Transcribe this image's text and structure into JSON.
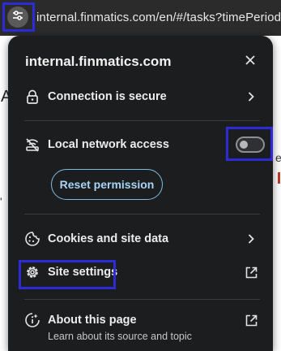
{
  "address_bar": {
    "url": "internal.finmatics.com/en/#/tasks?timePeriod="
  },
  "page_peek": {
    "left_letter": "A",
    "left_mark": "'",
    "right_letter": "e"
  },
  "popup": {
    "title": "internal.finmatics.com",
    "connection_label": "Connection is secure",
    "local_network_label": "Local network access",
    "local_network_enabled": false,
    "reset_permission_label": "Reset permission",
    "cookies_label": "Cookies and site data",
    "site_settings_label": "Site settings",
    "about_label": "About this page",
    "about_sub": "Learn about its source and topic"
  },
  "colors": {
    "highlight": "#2d2bd8",
    "popup_bg": "#1c1d1f",
    "reset_button_text": "#a8d4f5"
  },
  "icons": {
    "site_info": "tune-icon",
    "close": "close-icon",
    "connection": "lock-icon",
    "local_network": "network-off-icon",
    "cookies": "cookie-icon",
    "site_settings": "gear-icon",
    "about": "info-icon",
    "chevron": "chevron-right-icon",
    "external": "open-external-icon"
  }
}
